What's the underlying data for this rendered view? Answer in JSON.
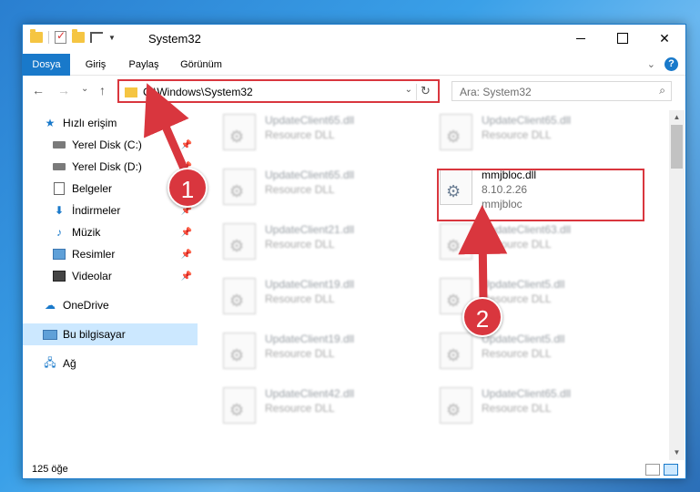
{
  "titlebar": {
    "title": "System32"
  },
  "ribbon": {
    "tabs": [
      "Dosya",
      "Giriş",
      "Paylaş",
      "Görünüm"
    ],
    "help": "?"
  },
  "navbar": {
    "back": "←",
    "forward": "→",
    "recent": "⌄",
    "up": "↑",
    "address": "C:\\Windows\\System32",
    "address_dd": "⌄",
    "refresh": "↻",
    "search_placeholder": "Ara: System32"
  },
  "sidebar": {
    "items": [
      {
        "label": "Hızlı erişim",
        "icon": "star-icon"
      },
      {
        "label": "Yerel Disk (C:)",
        "icon": "disk-icon",
        "pinned": true
      },
      {
        "label": "Yerel Disk (D:)",
        "icon": "disk-icon",
        "pinned": true
      },
      {
        "label": "Belgeler",
        "icon": "document-icon",
        "pinned": true
      },
      {
        "label": "İndirmeler",
        "icon": "download-icon",
        "pinned": true
      },
      {
        "label": "Müzik",
        "icon": "music-icon",
        "pinned": true
      },
      {
        "label": "Resimler",
        "icon": "picture-icon",
        "pinned": true
      },
      {
        "label": "Videolar",
        "icon": "video-icon",
        "pinned": true
      },
      {
        "label": "OneDrive",
        "icon": "cloud-icon"
      },
      {
        "label": "Bu bilgisayar",
        "icon": "computer-icon",
        "selected": true
      },
      {
        "label": "Ağ",
        "icon": "network-icon"
      }
    ]
  },
  "files": [
    {
      "name": "UpdateClient65.dll",
      "sub": "Resource DLL"
    },
    {
      "name": "UpdateClient65.dll",
      "sub": "Resource DLL"
    },
    {
      "name": "UpdateClient65.dll",
      "sub": "Resource DLL"
    },
    {
      "name": "mmjbloc.dll",
      "sub": "8.10.2.26",
      "sub2": "mmjbloc"
    },
    {
      "name": "UpdateClient21.dll",
      "sub": "Resource DLL"
    },
    {
      "name": "UpdateClient63.dll",
      "sub": "Resource DLL"
    },
    {
      "name": "UpdateClient19.dll",
      "sub": "Resource DLL"
    },
    {
      "name": "UpdateClient5.dll",
      "sub": "Resource DLL"
    },
    {
      "name": "UpdateClient19.dll",
      "sub": "Resource DLL"
    },
    {
      "name": "UpdateClient5.dll",
      "sub": "Resource DLL"
    },
    {
      "name": "UpdateClient42.dll",
      "sub": "Resource DLL"
    },
    {
      "name": "UpdateClient65.dll",
      "sub": "Resource DLL"
    }
  ],
  "status": {
    "count": "125 öğe"
  },
  "annotations": {
    "step1": "1",
    "step2": "2",
    "color": "#d9363e"
  }
}
